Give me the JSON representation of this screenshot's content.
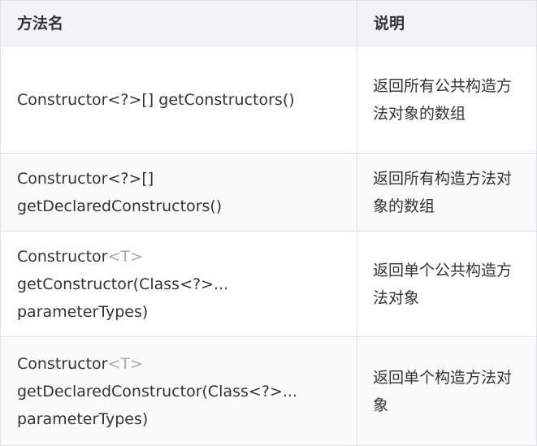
{
  "table": {
    "headers": {
      "method": "方法名",
      "description": "说明"
    },
    "rows": [
      {
        "method_line1": "Constructor<?>[] getConstructors()",
        "description": "返回所有公共构造方法对象的数组"
      },
      {
        "method_line1": "Constructor<?>[]",
        "method_line2": "getDeclaredConstructors()",
        "description": "返回所有构造方法对象的数组"
      },
      {
        "method_prefix": "Constructor",
        "method_generic": "<T>",
        "method_line2": "getConstructor(Class<?>...",
        "method_line3": "parameterTypes)",
        "description": "返回单个公共构造方法对象"
      },
      {
        "method_prefix": "Constructor",
        "method_generic": "<T>",
        "method_line2": "getDeclaredConstructor(Class<?>...",
        "method_line3": "parameterTypes)",
        "description": "返回单个构造方法对象"
      }
    ]
  }
}
